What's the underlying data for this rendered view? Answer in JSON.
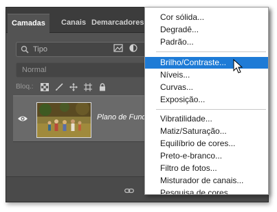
{
  "panel": {
    "tabs": [
      {
        "label": "Camadas",
        "active": true
      },
      {
        "label": "Canais",
        "active": false
      },
      {
        "label": "Demarcadores",
        "active": false
      }
    ],
    "search_placeholder": "Tipo",
    "blend_mode": "Normal",
    "lock_label": "Bloq.:",
    "layer": {
      "name": "Plano de Fundo"
    }
  },
  "menu": {
    "group1": [
      "Cor sólida...",
      "Degradê...",
      "Padrão..."
    ],
    "group2": [
      "Brilho/Contraste...",
      "Níveis...",
      "Curvas...",
      "Exposição..."
    ],
    "group3": [
      "Vibratilidade...",
      "Matiz/Saturação...",
      "Equilíbrio de cores...",
      "Preto-e-branco...",
      "Filtro de fotos...",
      "Misturador de canais...",
      "Pesquisa de cores..."
    ],
    "selected": "Brilho/Contraste..."
  },
  "colors": {
    "highlight": "#1e7bd6",
    "panel": "#535353",
    "layer": "#6a6a6a"
  },
  "icons": [
    "search-icon",
    "image-filter-icon",
    "adjustment-filter-icon",
    "lock-transparency-icon",
    "lock-paint-icon",
    "lock-move-icon",
    "lock-artboard-icon",
    "lock-all-icon",
    "eye-icon",
    "link-icon",
    "cursor-icon"
  ]
}
